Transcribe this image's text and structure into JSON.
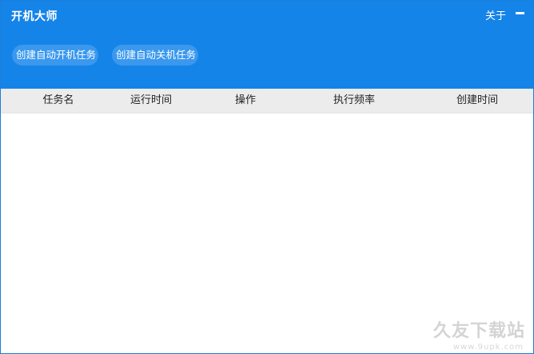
{
  "window": {
    "title": "开机大师",
    "about_label": "关于",
    "minimize_icon": "minimize-icon"
  },
  "toolbar": {
    "create_power_on_label": "创建自动开机任务",
    "create_power_off_label": "创建自动关机任务"
  },
  "table": {
    "columns": [
      "任务名",
      "运行时间",
      "操作",
      "执行频率",
      "创建时间"
    ],
    "rows": []
  },
  "watermark": {
    "text": "久友下载站",
    "url": "www.9upk.com"
  },
  "colors": {
    "header_bg": "#1584e8",
    "button_bg": "#3a98ee",
    "table_header_bg": "#ececec"
  }
}
